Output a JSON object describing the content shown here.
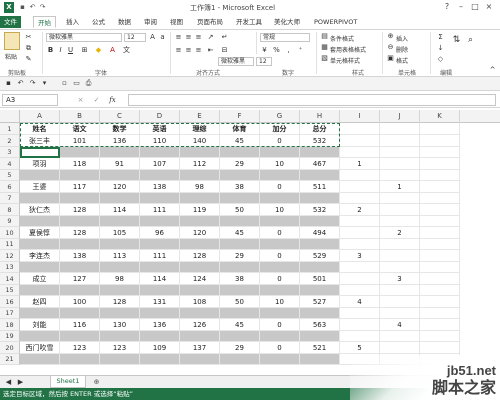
{
  "window": {
    "title": "工作簿1 - Microsoft Excel",
    "app_icon": "X"
  },
  "tabs": [
    "文件",
    "开始",
    "插入",
    "公式",
    "数据",
    "审阅",
    "视图",
    "页面布局",
    "开发工具",
    "美化大师",
    "POWERPIVOT"
  ],
  "ribbon": {
    "paste_label": "粘贴",
    "font_name": "微软雅黑",
    "font_size": "12",
    "number_format": "常规",
    "cond_format": "条件格式",
    "table_format": "套用表格格式",
    "cell_style": "单元格样式",
    "insert": "插入",
    "delete": "删除",
    "format": "格式",
    "groups": [
      "剪贴板",
      "字体",
      "对齐方式",
      "数字",
      "样式",
      "单元格",
      "编辑"
    ],
    "inline_font": "微软雅黑",
    "inline_size": "12"
  },
  "formula_bar": {
    "name_box": "A3",
    "fx": "fx",
    "value": ""
  },
  "columns": [
    "A",
    "B",
    "C",
    "D",
    "E",
    "F",
    "G",
    "H",
    "I",
    "J",
    "K"
  ],
  "rows": [
    {
      "n": "1",
      "gray": false,
      "cells": [
        "姓名",
        "语文",
        "数学",
        "英语",
        "理综",
        "体育",
        "加分",
        "总分",
        "",
        "",
        ""
      ],
      "hdr": true
    },
    {
      "n": "2",
      "gray": false,
      "cells": [
        "张三丰",
        "101",
        "136",
        "110",
        "140",
        "45",
        "0",
        "532",
        "",
        "",
        ""
      ]
    },
    {
      "n": "3",
      "gray": true,
      "cells": [
        "",
        "",
        "",
        "",
        "",
        "",
        "",
        "",
        "",
        "",
        ""
      ]
    },
    {
      "n": "4",
      "gray": false,
      "cells": [
        "项羽",
        "118",
        "91",
        "107",
        "112",
        "29",
        "10",
        "467",
        "1",
        "",
        ""
      ]
    },
    {
      "n": "5",
      "gray": true,
      "cells": [
        "",
        "",
        "",
        "",
        "",
        "",
        "",
        "",
        "",
        "",
        ""
      ]
    },
    {
      "n": "6",
      "gray": false,
      "cells": [
        "王婆",
        "117",
        "120",
        "138",
        "98",
        "38",
        "0",
        "511",
        "",
        "1",
        ""
      ]
    },
    {
      "n": "7",
      "gray": true,
      "cells": [
        "",
        "",
        "",
        "",
        "",
        "",
        "",
        "",
        "",
        "",
        ""
      ]
    },
    {
      "n": "8",
      "gray": false,
      "cells": [
        "狄仁杰",
        "128",
        "114",
        "111",
        "119",
        "50",
        "10",
        "532",
        "2",
        "",
        ""
      ]
    },
    {
      "n": "9",
      "gray": true,
      "cells": [
        "",
        "",
        "",
        "",
        "",
        "",
        "",
        "",
        "",
        "",
        ""
      ]
    },
    {
      "n": "10",
      "gray": false,
      "cells": [
        "夏侯惇",
        "128",
        "105",
        "96",
        "120",
        "45",
        "0",
        "494",
        "",
        "2",
        ""
      ]
    },
    {
      "n": "11",
      "gray": true,
      "cells": [
        "",
        "",
        "",
        "",
        "",
        "",
        "",
        "",
        "",
        "",
        ""
      ]
    },
    {
      "n": "12",
      "gray": false,
      "cells": [
        "李连杰",
        "138",
        "113",
        "111",
        "128",
        "29",
        "0",
        "529",
        "3",
        "",
        ""
      ]
    },
    {
      "n": "13",
      "gray": true,
      "cells": [
        "",
        "",
        "",
        "",
        "",
        "",
        "",
        "",
        "",
        "",
        ""
      ]
    },
    {
      "n": "14",
      "gray": false,
      "cells": [
        "成立",
        "127",
        "98",
        "114",
        "124",
        "38",
        "0",
        "501",
        "",
        "3",
        ""
      ]
    },
    {
      "n": "15",
      "gray": true,
      "cells": [
        "",
        "",
        "",
        "",
        "",
        "",
        "",
        "",
        "",
        "",
        ""
      ]
    },
    {
      "n": "16",
      "gray": false,
      "cells": [
        "赵四",
        "100",
        "128",
        "131",
        "108",
        "50",
        "10",
        "527",
        "4",
        "",
        ""
      ]
    },
    {
      "n": "17",
      "gray": true,
      "cells": [
        "",
        "",
        "",
        "",
        "",
        "",
        "",
        "",
        "",
        "",
        ""
      ]
    },
    {
      "n": "18",
      "gray": false,
      "cells": [
        "刘能",
        "116",
        "130",
        "136",
        "126",
        "45",
        "0",
        "563",
        "",
        "4",
        ""
      ]
    },
    {
      "n": "19",
      "gray": true,
      "cells": [
        "",
        "",
        "",
        "",
        "",
        "",
        "",
        "",
        "",
        "",
        ""
      ]
    },
    {
      "n": "20",
      "gray": false,
      "cells": [
        "西门吹雪",
        "123",
        "123",
        "109",
        "137",
        "29",
        "0",
        "521",
        "5",
        "",
        ""
      ]
    },
    {
      "n": "21",
      "gray": true,
      "cells": [
        "",
        "",
        "",
        "",
        "",
        "",
        "",
        "",
        "",
        "",
        ""
      ]
    }
  ],
  "sheet_tab": "Sheet1",
  "status_text": "选定目标区域，然后按 ENTER 或选择“粘贴”",
  "watermark": {
    "line1": "jb51.net",
    "line2": "脚本之家"
  },
  "colors": {
    "excel_green": "#217346",
    "gray_row": "#c8c8c8"
  }
}
